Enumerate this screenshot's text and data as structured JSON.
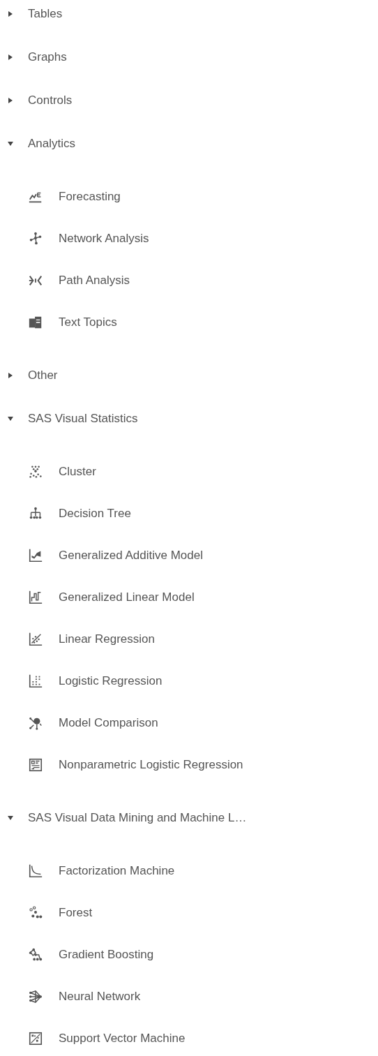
{
  "sections": [
    {
      "label": "Tables",
      "expanded": false
    },
    {
      "label": "Graphs",
      "expanded": false
    },
    {
      "label": "Controls",
      "expanded": false
    },
    {
      "label": "Analytics",
      "expanded": true,
      "children": [
        {
          "label": "Forecasting",
          "kind": "forecast"
        },
        {
          "label": "Network Analysis",
          "kind": "network"
        },
        {
          "label": "Path Analysis",
          "kind": "path"
        },
        {
          "label": "Text Topics",
          "kind": "documents"
        }
      ]
    },
    {
      "label": "Other",
      "expanded": false
    },
    {
      "label": "SAS Visual Statistics",
      "expanded": true,
      "children": [
        {
          "label": "Cluster",
          "kind": "cluster"
        },
        {
          "label": "Decision Tree",
          "kind": "tree"
        },
        {
          "label": "Generalized Additive Model",
          "kind": "area"
        },
        {
          "label": "Generalized Linear Model",
          "kind": "step"
        },
        {
          "label": "Linear Regression",
          "kind": "scatterline"
        },
        {
          "label": "Logistic Regression",
          "kind": "dots"
        },
        {
          "label": "Model Comparison",
          "kind": "compare"
        },
        {
          "label": "Nonparametric Logistic Regression",
          "kind": "grid"
        }
      ]
    },
    {
      "label": "SAS Visual Data Mining and Machine L…",
      "expanded": true,
      "children": [
        {
          "label": "Factorization Machine",
          "kind": "curve"
        },
        {
          "label": "Forest",
          "kind": "forest"
        },
        {
          "label": "Gradient Boosting",
          "kind": "boost"
        },
        {
          "label": "Neural Network",
          "kind": "neural"
        },
        {
          "label": "Support Vector Machine",
          "kind": "svm"
        }
      ]
    }
  ]
}
